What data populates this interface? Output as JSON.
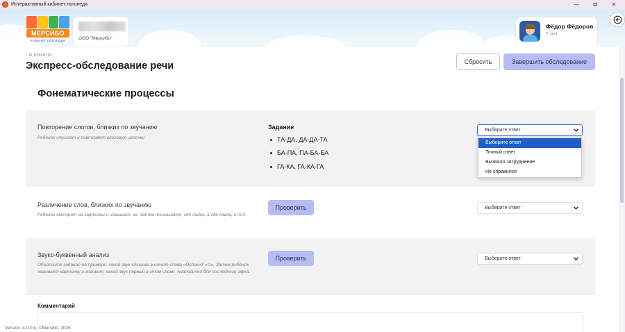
{
  "window": {
    "title": "Интерактивный кабинет логопеда",
    "minimize_glyph": "—",
    "restore_glyph": "⧉",
    "close_glyph": "✕"
  },
  "header": {
    "logo_word": "МЕРСИБО",
    "logo_sub": "КАБИНЕТ ЛОГОПЕДА",
    "logo_colors": [
      "#ff6b3d",
      "#ffc21a",
      "#3fb24a",
      "#4aa3e8"
    ],
    "org_name": "ООО \"Мерсибо\"",
    "user_name": "Фёдор Фёдоров",
    "user_age": "7 лет",
    "exit_icon": "exit-icon"
  },
  "page": {
    "back_link": "‹ в начало",
    "title": "Экспресс-обследование речи",
    "reset_label": "Сбросить",
    "finish_label": "Завершить обследование",
    "section_title": "Фонематические процессы"
  },
  "rows": [
    {
      "title": "Повторение слогов, близких по звучанию",
      "desc": "Ребенок слушает и повторяет слоговую цепочку",
      "task_head": "Задание",
      "tasks": [
        "ТА-ДА, ДА-ДА-ТА",
        "БА-ПА, ПА-БА-БА",
        "ГА-КА, ГА-КА-ГА"
      ],
      "select_value": "Выберите ответ"
    },
    {
      "title": "Различение слов, близких по звучанию",
      "desc": "Ребенок смотрит на картинки и называет их. Затем показывает, где лайка, а где лавка, и т.д.",
      "button": "Проверить",
      "select_value": "Выберите ответ"
    },
    {
      "title": "Звуко-буквенный анализ",
      "desc": "Объясните задание на примере: какой звук слышим в начале слова «Ослик»? «О». Затем ребенок называет картинку и говорит, какой звук первый в этом слове. Аналогично для последнего звука.",
      "button": "Проверить",
      "select_value": "Выберите ответ"
    }
  ],
  "dropdown_options": [
    "Выберите ответ",
    "Точный ответ",
    "Вызвало затруднение",
    "Не справился"
  ],
  "comment_label": "Комментарий",
  "version": "Version: 4.0.0.o, ©Mersibo, 2026",
  "colors": {
    "accent_button": "#b6bdf3",
    "dropdown_selected": "#1f5fc7",
    "panel_gray": "#f2f2f3"
  }
}
